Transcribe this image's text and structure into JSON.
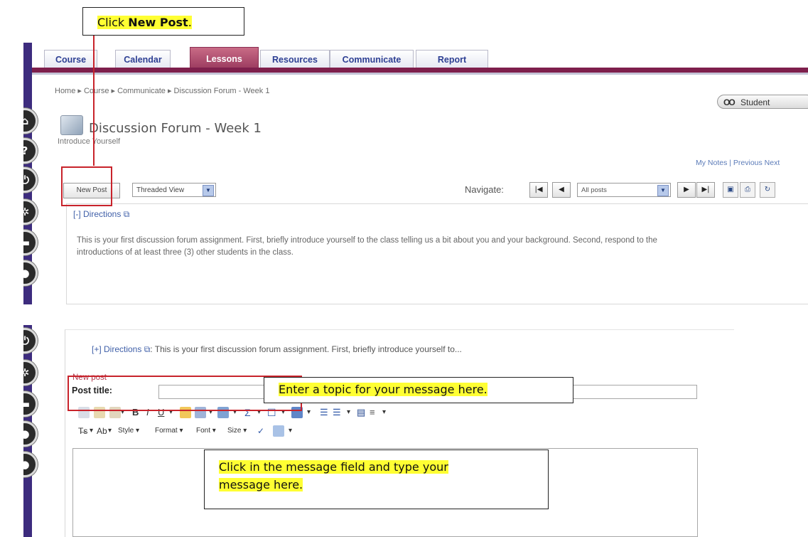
{
  "annotations": {
    "click_new_post_prefix": "Click ",
    "click_new_post_bold": "New Post",
    "click_new_post_suffix": ".",
    "enter_topic": "Enter a topic for your message here.",
    "message_field_line1": "Click in the message field and type your",
    "message_field_line2": "message here."
  },
  "tabs": [
    {
      "label": "Course",
      "active": false
    },
    {
      "label": "Calendar",
      "active": false
    },
    {
      "label": "Lessons",
      "active": true
    },
    {
      "label": "Resources",
      "active": false
    },
    {
      "label": "Communicate",
      "active": false
    },
    {
      "label": "Report",
      "active": false
    }
  ],
  "breadcrumb": "Home ▸ Course ▸ Communicate ▸ Discussion Forum - Week 1",
  "student_button": "Student",
  "page": {
    "title": "Discussion Forum - Week 1",
    "subtitle": "Introduce Yourself",
    "links": "My Notes | Previous Next"
  },
  "toolbar": {
    "new_post": "New Post",
    "view_select": "Threaded View",
    "navigate_label": "Navigate:",
    "posts_select": "All posts"
  },
  "directions": {
    "header": "[-] Directions",
    "text": "This is your first discussion forum assignment.  First, briefly introduce yourself to the class telling us a bit about you and your background.  Second, respond to the introductions of at least three (3) other students in the class.",
    "collapsed_prefix": "[+] Directions",
    "collapsed_text": ": This is your first discussion forum assignment.  First, briefly introduce yourself to..."
  },
  "new_post_form": {
    "section_label": "New post",
    "post_title_label": "Post title:",
    "post_title_value": "",
    "toolbar2": {
      "style": "Style",
      "format": "Format",
      "font": "Font",
      "size": "Size"
    }
  },
  "icons": {
    "sidebar": [
      "home-icon",
      "help-icon",
      "power-icon",
      "gear-icon",
      "folder-icon",
      "chat-icon"
    ],
    "sidebar_bottom": [
      "power-icon",
      "gear-icon",
      "folder-icon",
      "person-icon",
      "chat-icon"
    ]
  },
  "colors": {
    "tab_accent": "#7e1f4c",
    "sidebar": "#3d2c7e",
    "annotation_red": "#c8232b",
    "highlight": "#ffff33"
  }
}
